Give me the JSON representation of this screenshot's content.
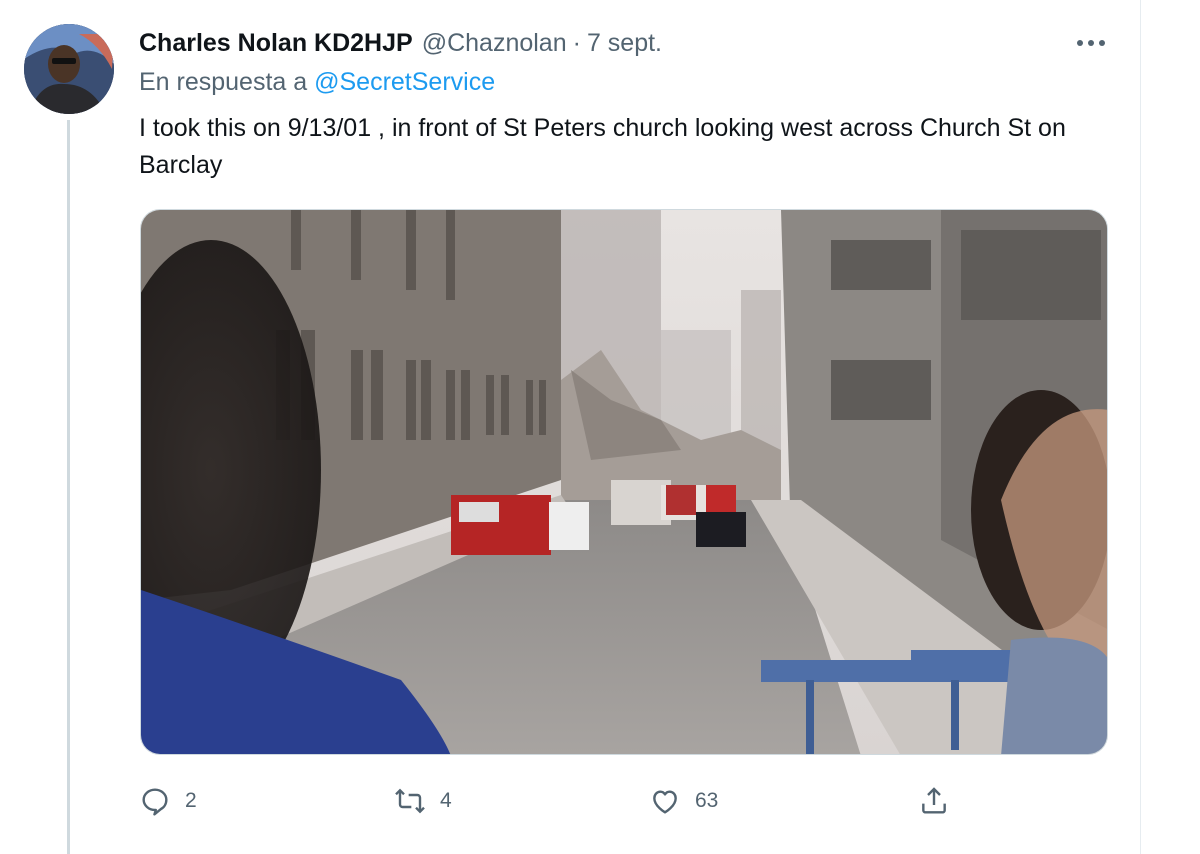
{
  "tweet": {
    "author_name": "Charles Nolan KD2HJP",
    "handle": "@Chaznolan",
    "separator": "·",
    "date": "7 sept.",
    "more_label": "···",
    "reply_prefix": "En respuesta a",
    "reply_mention": "@SecretService",
    "text": "I took this on 9/13/01 , in front of St Peters church looking west across Church St on Barclay",
    "media": {
      "description_icon": "photo",
      "accent": "#1d9bf0"
    },
    "actions": [
      {
        "name": "reply",
        "icon": "reply-icon",
        "count": "2"
      },
      {
        "name": "retweet",
        "icon": "retweet-icon",
        "count": "4"
      },
      {
        "name": "like",
        "icon": "like-icon",
        "count": "63"
      },
      {
        "name": "share",
        "icon": "share-icon",
        "count": ""
      }
    ]
  },
  "colors": {
    "text": "#0f1419",
    "secondary": "#536471",
    "link": "#1d9bf0",
    "thread_line": "#cfd9de"
  }
}
